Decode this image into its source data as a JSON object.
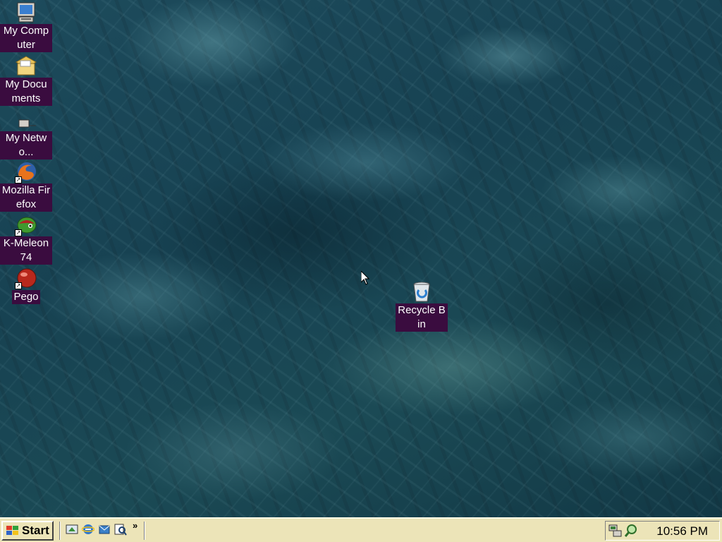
{
  "desktop": {
    "icons": [
      {
        "label": "My Computer",
        "icon": "computer-icon"
      },
      {
        "label": "My Documents",
        "icon": "folder-icon"
      },
      {
        "label": "My Netwo...",
        "icon": "network-icon"
      },
      {
        "label": "Mozilla Firefox",
        "icon": "firefox-icon"
      },
      {
        "label": "K-Meleon 74",
        "icon": "kmeleon-icon"
      },
      {
        "label": "Pego",
        "icon": "pego-icon"
      },
      {
        "label": "Recycle Bin",
        "icon": "recycle-bin-icon"
      }
    ]
  },
  "taskbar": {
    "start_label": "Start",
    "quick_launch": [
      "show-desktop-icon",
      "internet-explorer-icon",
      "outlook-icon",
      "search-icon"
    ],
    "overflow_label": "»",
    "tray_icons": [
      "network-tray-icon",
      "search-tray-icon"
    ],
    "clock": "10:56 PM"
  },
  "colors": {
    "icon_label_bg": "#3a0c3f",
    "taskbar_bg": "#ece4b8"
  }
}
